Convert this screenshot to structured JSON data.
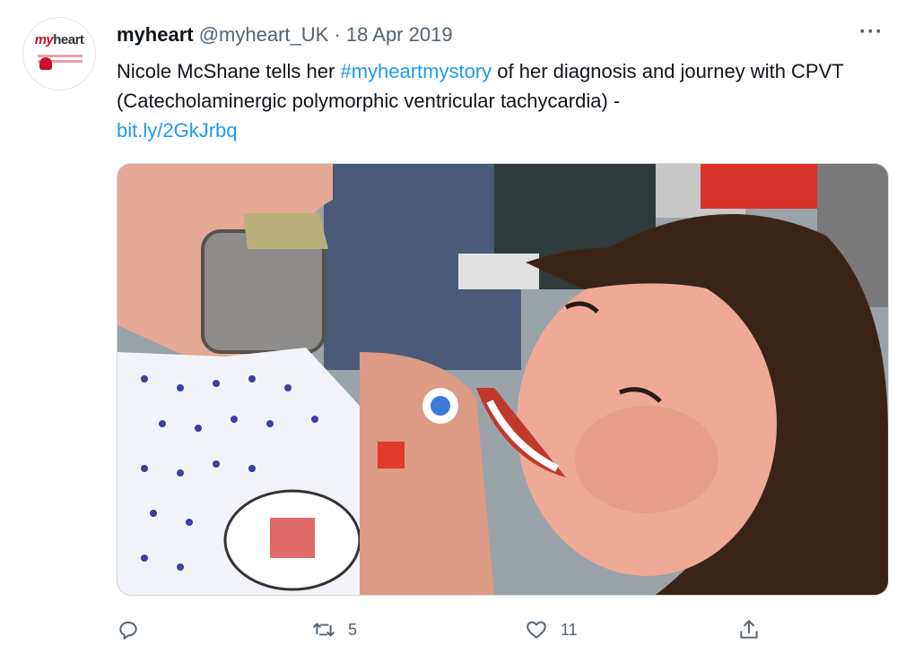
{
  "tweet": {
    "author_name": "myheart",
    "author_handle": "@myheart_UK",
    "separator": "·",
    "date": "18 Apr 2019",
    "text_before": "Nicole McShane tells her ",
    "hashtag": "#myheartmystory",
    "text_after": " of her diagnosis and journey with CPVT (Catecholaminergic polymorphic ventricular tachycardia) -",
    "link": "bit.ly/2GkJrbq",
    "avatar": {
      "logo_my": "my",
      "logo_heart": "heart"
    },
    "more_label": "···",
    "media": {
      "icon": "photo",
      "description_colors": {
        "skin": "#e8a08c",
        "hair": "#3a2418",
        "gown": "#f4f4f8"
      }
    },
    "actions": {
      "reply": {
        "icon": "reply-icon",
        "count": ""
      },
      "retweet": {
        "icon": "retweet-icon",
        "count": "5"
      },
      "like": {
        "icon": "heart-icon",
        "count": "11"
      },
      "share": {
        "icon": "share-icon",
        "count": ""
      }
    }
  },
  "colors": {
    "link": "#1d9bf0",
    "secondary": "#536471",
    "brand": "#c8102e"
  }
}
